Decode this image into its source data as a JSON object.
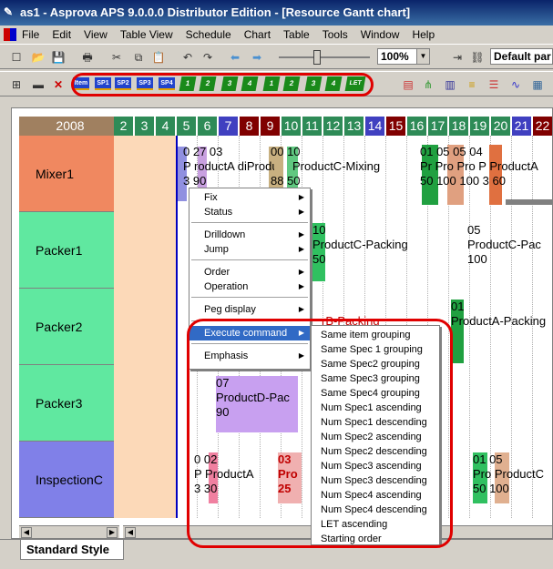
{
  "window": {
    "title": "as1 - Asprova APS 9.0.0.0 Distributor Edition - [Resource Gantt chart]"
  },
  "menu": [
    "File",
    "Edit",
    "View",
    "Table View",
    "Schedule",
    "Chart",
    "Table",
    "Tools",
    "Window",
    "Help"
  ],
  "toolbar": {
    "zoom": "100%",
    "style": "Default par",
    "spec_buttons": [
      "Item",
      "SP1",
      "SP2",
      "SP3",
      "SP4"
    ],
    "green_buttons": [
      "1",
      "2",
      "3",
      "4",
      "1",
      "2",
      "3",
      "4"
    ],
    "let_button": "LET"
  },
  "gantt": {
    "year": "2008",
    "days": [
      "2",
      "3",
      "4",
      "5",
      "6",
      "7",
      "8",
      "9",
      "10",
      "11",
      "12",
      "13",
      "14",
      "15",
      "16",
      "17",
      "18",
      "19",
      "20",
      "21",
      "22"
    ],
    "day_colors": [
      "#2e8b57",
      "#2e8b57",
      "#2e8b57",
      "#2e8b57",
      "#2e8b57",
      "#4040c0",
      "#800000",
      "#800000",
      "#2e8b57",
      "#2e8b57",
      "#2e8b57",
      "#2e8b57",
      "#4040c0",
      "#800000",
      "#2e8b57",
      "#2e8b57",
      "#2e8b57",
      "#2e8b57",
      "#2e8b57",
      "#4040c0",
      "#800000"
    ],
    "resources": [
      {
        "name": "Mixer1",
        "color": "#f08860"
      },
      {
        "name": "Packer1",
        "color": "#60e8a0"
      },
      {
        "name": "Packer2",
        "color": "#60e8a0"
      },
      {
        "name": "Packer3",
        "color": "#60e8a0"
      },
      {
        "name": "InspectionC",
        "color": "#8080e8"
      }
    ],
    "tasks": {
      "mixer_a": "0 27 03",
      "mixer_a2": "P roductA diProductD-Mixing",
      "mixer_a3": "3 90",
      "mixer_b": "00 10",
      "mixer_b2": "ProductC-Mixing",
      "mixer_b3": "88 50",
      "mixer_c": "01 05 05 04",
      "mixer_c2": "Pr Pro Pro P ProductA",
      "mixer_c3": "50 100 100 3 60",
      "packer1_a": "10",
      "packer1_a2": "ProductC-Packing",
      "packer1_a3": "50",
      "packer1_b": "05",
      "packer1_b2": "ProductC-Pac",
      "packer1_b3": "100",
      "packer2_a": "rB-Packing",
      "packer2_b": "01",
      "packer2_b2": "ProductA-Packing",
      "packer3_a": "07",
      "packer3_a2": "ProductD-Pac",
      "packer3_a3": "90",
      "insp_a": "0 02",
      "insp_a2": "P ProductA",
      "insp_a3": "3 30",
      "insp_b": "03",
      "insp_b2": "Pro",
      "insp_b3": "25",
      "insp_c": "01 05",
      "insp_c2": "Pro ProductC",
      "insp_c3": "50 100"
    }
  },
  "context_menu": {
    "items": [
      "Fix",
      "Status",
      "Drilldown",
      "Jump",
      "Order",
      "Operation",
      "Peg display",
      "Execute command",
      "Emphasis"
    ]
  },
  "submenu": {
    "items": [
      "Same item grouping",
      "Same Spec 1 grouping",
      "Same Spec2 grouping",
      "Same Spec3 grouping",
      "Same Spec4 grouping",
      "Num Spec1 ascending",
      "Num Spec1 descending",
      "Num Spec2 ascending",
      "Num Spec2 descending",
      "Num Spec3 ascending",
      "Num Spec3 descending",
      "Num Spec4 ascending",
      "Num Spec4 descending",
      "LET ascending",
      "Starting order"
    ]
  },
  "tabs": {
    "active": "Standard Style"
  }
}
